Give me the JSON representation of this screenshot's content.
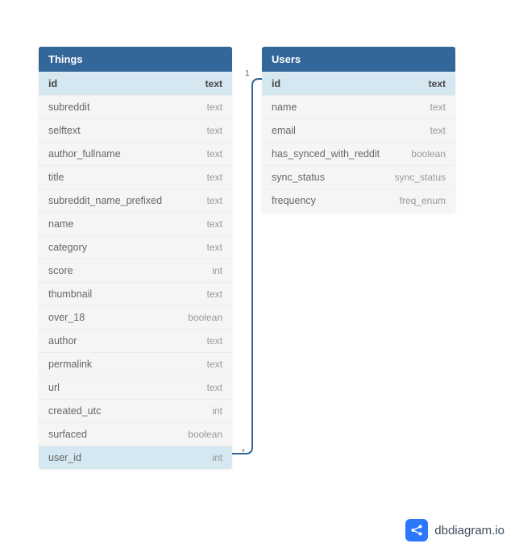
{
  "tables": {
    "things": {
      "title": "Things",
      "columns": [
        {
          "name": "id",
          "type": "text",
          "pk": true,
          "highlight": true
        },
        {
          "name": "subreddit",
          "type": "text"
        },
        {
          "name": "selftext",
          "type": "text"
        },
        {
          "name": "author_fullname",
          "type": "text"
        },
        {
          "name": "title",
          "type": "text"
        },
        {
          "name": "subreddit_name_prefixed",
          "type": "text"
        },
        {
          "name": "name",
          "type": "text"
        },
        {
          "name": "category",
          "type": "text"
        },
        {
          "name": "score",
          "type": "int"
        },
        {
          "name": "thumbnail",
          "type": "text"
        },
        {
          "name": "over_18",
          "type": "boolean"
        },
        {
          "name": "author",
          "type": "text"
        },
        {
          "name": "permalink",
          "type": "text"
        },
        {
          "name": "url",
          "type": "text"
        },
        {
          "name": "created_utc",
          "type": "int"
        },
        {
          "name": "surfaced",
          "type": "boolean"
        },
        {
          "name": "user_id",
          "type": "int",
          "highlight": true
        }
      ]
    },
    "users": {
      "title": "Users",
      "columns": [
        {
          "name": "id",
          "type": "text",
          "pk": true,
          "highlight": true
        },
        {
          "name": "name",
          "type": "text"
        },
        {
          "name": "email",
          "type": "text"
        },
        {
          "name": "has_synced_with_reddit",
          "type": "boolean"
        },
        {
          "name": "sync_status",
          "type": "sync_status"
        },
        {
          "name": "frequency",
          "type": "freq_enum"
        }
      ]
    }
  },
  "relation": {
    "from_label": "*",
    "to_label": "1"
  },
  "brand": {
    "name": "dbdiagram.io"
  }
}
